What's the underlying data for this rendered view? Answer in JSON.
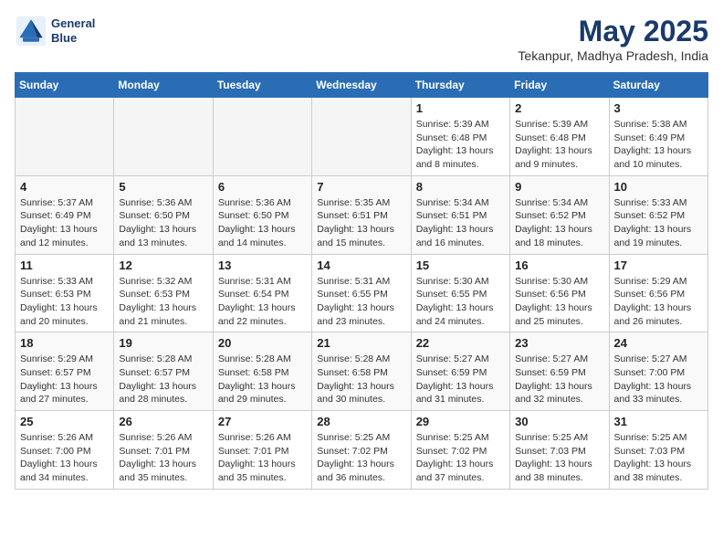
{
  "header": {
    "logo_line1": "General",
    "logo_line2": "Blue",
    "title": "May 2025",
    "subtitle": "Tekanpur, Madhya Pradesh, India"
  },
  "days_of_week": [
    "Sunday",
    "Monday",
    "Tuesday",
    "Wednesday",
    "Thursday",
    "Friday",
    "Saturday"
  ],
  "weeks": [
    [
      {
        "day": "",
        "info": ""
      },
      {
        "day": "",
        "info": ""
      },
      {
        "day": "",
        "info": ""
      },
      {
        "day": "",
        "info": ""
      },
      {
        "day": "1",
        "info": "Sunrise: 5:39 AM\nSunset: 6:48 PM\nDaylight: 13 hours\nand 8 minutes."
      },
      {
        "day": "2",
        "info": "Sunrise: 5:39 AM\nSunset: 6:48 PM\nDaylight: 13 hours\nand 9 minutes."
      },
      {
        "day": "3",
        "info": "Sunrise: 5:38 AM\nSunset: 6:49 PM\nDaylight: 13 hours\nand 10 minutes."
      }
    ],
    [
      {
        "day": "4",
        "info": "Sunrise: 5:37 AM\nSunset: 6:49 PM\nDaylight: 13 hours\nand 12 minutes."
      },
      {
        "day": "5",
        "info": "Sunrise: 5:36 AM\nSunset: 6:50 PM\nDaylight: 13 hours\nand 13 minutes."
      },
      {
        "day": "6",
        "info": "Sunrise: 5:36 AM\nSunset: 6:50 PM\nDaylight: 13 hours\nand 14 minutes."
      },
      {
        "day": "7",
        "info": "Sunrise: 5:35 AM\nSunset: 6:51 PM\nDaylight: 13 hours\nand 15 minutes."
      },
      {
        "day": "8",
        "info": "Sunrise: 5:34 AM\nSunset: 6:51 PM\nDaylight: 13 hours\nand 16 minutes."
      },
      {
        "day": "9",
        "info": "Sunrise: 5:34 AM\nSunset: 6:52 PM\nDaylight: 13 hours\nand 18 minutes."
      },
      {
        "day": "10",
        "info": "Sunrise: 5:33 AM\nSunset: 6:52 PM\nDaylight: 13 hours\nand 19 minutes."
      }
    ],
    [
      {
        "day": "11",
        "info": "Sunrise: 5:33 AM\nSunset: 6:53 PM\nDaylight: 13 hours\nand 20 minutes."
      },
      {
        "day": "12",
        "info": "Sunrise: 5:32 AM\nSunset: 6:53 PM\nDaylight: 13 hours\nand 21 minutes."
      },
      {
        "day": "13",
        "info": "Sunrise: 5:31 AM\nSunset: 6:54 PM\nDaylight: 13 hours\nand 22 minutes."
      },
      {
        "day": "14",
        "info": "Sunrise: 5:31 AM\nSunset: 6:55 PM\nDaylight: 13 hours\nand 23 minutes."
      },
      {
        "day": "15",
        "info": "Sunrise: 5:30 AM\nSunset: 6:55 PM\nDaylight: 13 hours\nand 24 minutes."
      },
      {
        "day": "16",
        "info": "Sunrise: 5:30 AM\nSunset: 6:56 PM\nDaylight: 13 hours\nand 25 minutes."
      },
      {
        "day": "17",
        "info": "Sunrise: 5:29 AM\nSunset: 6:56 PM\nDaylight: 13 hours\nand 26 minutes."
      }
    ],
    [
      {
        "day": "18",
        "info": "Sunrise: 5:29 AM\nSunset: 6:57 PM\nDaylight: 13 hours\nand 27 minutes."
      },
      {
        "day": "19",
        "info": "Sunrise: 5:28 AM\nSunset: 6:57 PM\nDaylight: 13 hours\nand 28 minutes."
      },
      {
        "day": "20",
        "info": "Sunrise: 5:28 AM\nSunset: 6:58 PM\nDaylight: 13 hours\nand 29 minutes."
      },
      {
        "day": "21",
        "info": "Sunrise: 5:28 AM\nSunset: 6:58 PM\nDaylight: 13 hours\nand 30 minutes."
      },
      {
        "day": "22",
        "info": "Sunrise: 5:27 AM\nSunset: 6:59 PM\nDaylight: 13 hours\nand 31 minutes."
      },
      {
        "day": "23",
        "info": "Sunrise: 5:27 AM\nSunset: 6:59 PM\nDaylight: 13 hours\nand 32 minutes."
      },
      {
        "day": "24",
        "info": "Sunrise: 5:27 AM\nSunset: 7:00 PM\nDaylight: 13 hours\nand 33 minutes."
      }
    ],
    [
      {
        "day": "25",
        "info": "Sunrise: 5:26 AM\nSunset: 7:00 PM\nDaylight: 13 hours\nand 34 minutes."
      },
      {
        "day": "26",
        "info": "Sunrise: 5:26 AM\nSunset: 7:01 PM\nDaylight: 13 hours\nand 35 minutes."
      },
      {
        "day": "27",
        "info": "Sunrise: 5:26 AM\nSunset: 7:01 PM\nDaylight: 13 hours\nand 35 minutes."
      },
      {
        "day": "28",
        "info": "Sunrise: 5:25 AM\nSunset: 7:02 PM\nDaylight: 13 hours\nand 36 minutes."
      },
      {
        "day": "29",
        "info": "Sunrise: 5:25 AM\nSunset: 7:02 PM\nDaylight: 13 hours\nand 37 minutes."
      },
      {
        "day": "30",
        "info": "Sunrise: 5:25 AM\nSunset: 7:03 PM\nDaylight: 13 hours\nand 38 minutes."
      },
      {
        "day": "31",
        "info": "Sunrise: 5:25 AM\nSunset: 7:03 PM\nDaylight: 13 hours\nand 38 minutes."
      }
    ]
  ]
}
